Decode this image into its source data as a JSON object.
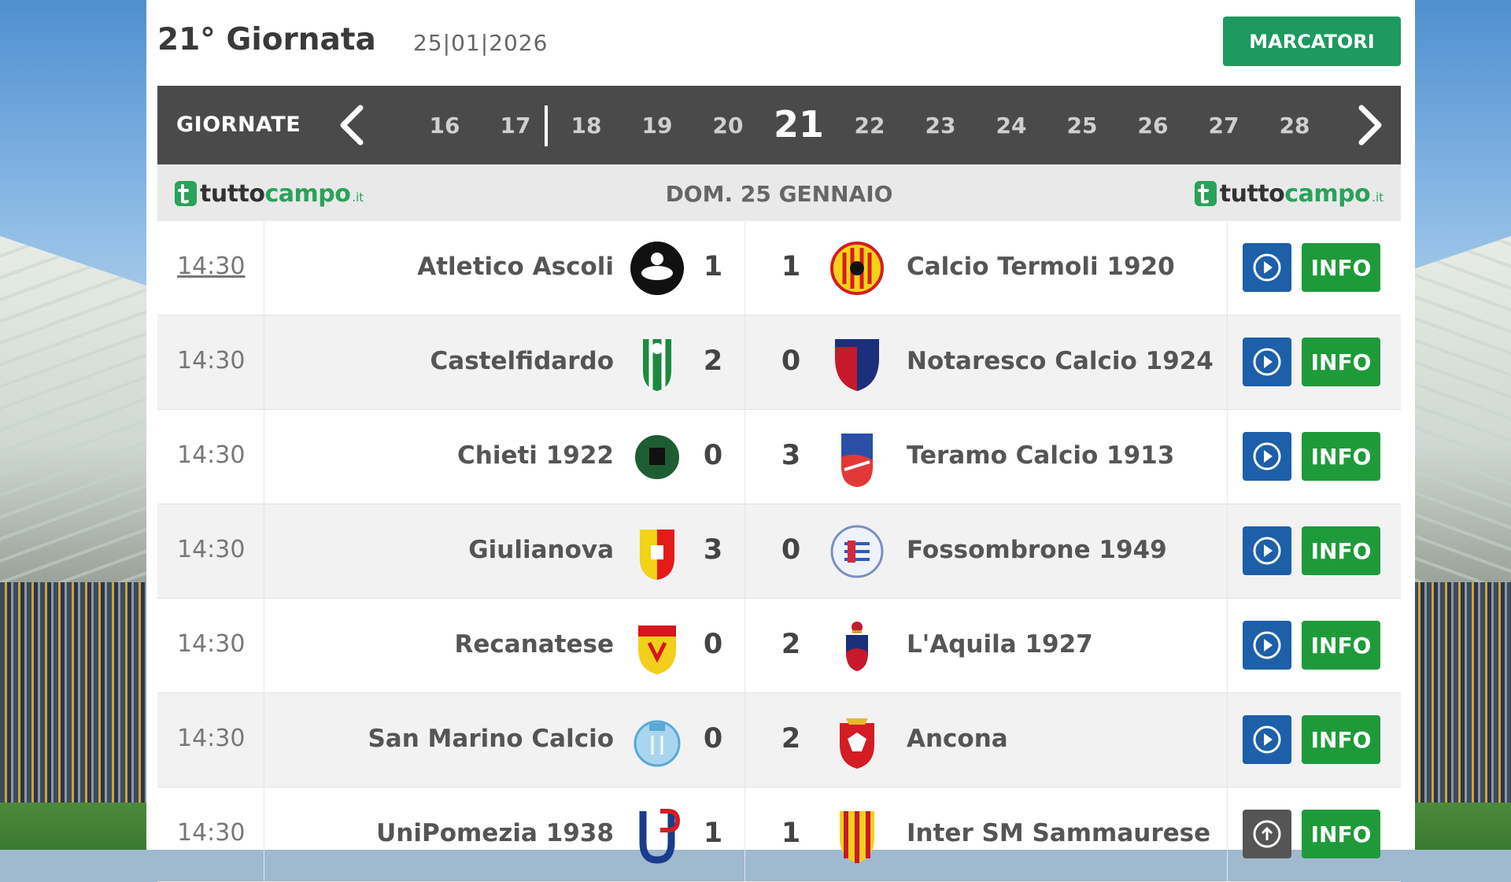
{
  "header": {
    "title": "21° Giornata",
    "date": "25|01|2026",
    "marcatori_label": "MARCATORI"
  },
  "nav": {
    "label": "GIORNATE",
    "days": [
      "16",
      "17",
      "18",
      "19",
      "20",
      "21",
      "22",
      "23",
      "24",
      "25",
      "26",
      "27",
      "28"
    ],
    "current": "21"
  },
  "date_bar": {
    "text": "DOM. 25 GENNAIO",
    "brand_a": "tutto",
    "brand_b": "campo",
    "brand_tld": ".it"
  },
  "colors": {
    "accent_green": "#1e9960",
    "info_green": "#1f9a3b",
    "video_blue": "#1d5fa8",
    "nav_bg": "#4a4a4a"
  },
  "matches": [
    {
      "time": "14:30",
      "home": "Atletico Ascoli",
      "home_score": "1",
      "away_score": "1",
      "away": "Calcio Termoli 1920",
      "info_label": "INFO",
      "video_icon": "play-icon"
    },
    {
      "time": "14:30",
      "home": "Castelfidardo",
      "home_score": "2",
      "away_score": "0",
      "away": "Notaresco Calcio 1924",
      "info_label": "INFO",
      "video_icon": "play-icon"
    },
    {
      "time": "14:30",
      "home": "Chieti 1922",
      "home_score": "0",
      "away_score": "3",
      "away": "Teramo Calcio 1913",
      "info_label": "INFO",
      "video_icon": "play-icon"
    },
    {
      "time": "14:30",
      "home": "Giulianova",
      "home_score": "3",
      "away_score": "0",
      "away": "Fossombrone 1949",
      "info_label": "INFO",
      "video_icon": "play-icon"
    },
    {
      "time": "14:30",
      "home": "Recanatese",
      "home_score": "0",
      "away_score": "2",
      "away": "L'Aquila 1927",
      "info_label": "INFO",
      "video_icon": "play-icon"
    },
    {
      "time": "14:30",
      "home": "San Marino Calcio",
      "home_score": "0",
      "away_score": "2",
      "away": "Ancona",
      "info_label": "INFO",
      "video_icon": "play-icon"
    },
    {
      "time": "14:30",
      "home": "UniPomezia 1938",
      "home_score": "1",
      "away_score": "1",
      "away": "Inter SM Sammaurese",
      "info_label": "INFO",
      "video_icon": "upload-icon"
    }
  ]
}
